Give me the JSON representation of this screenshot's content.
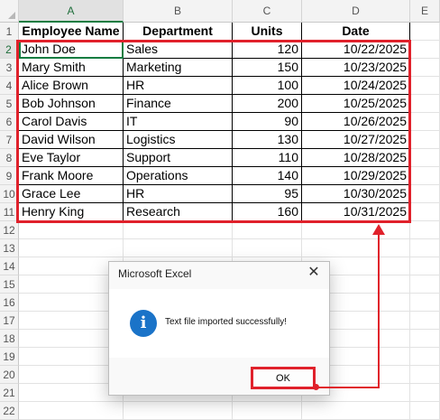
{
  "columns": [
    "A",
    "B",
    "C",
    "D",
    "E"
  ],
  "rows": [
    "1",
    "2",
    "3",
    "4",
    "5",
    "6",
    "7",
    "8",
    "9",
    "10",
    "11",
    "12",
    "13",
    "14",
    "15",
    "16",
    "17",
    "18",
    "19",
    "20",
    "21",
    "22"
  ],
  "table": {
    "headers": [
      "Employee Name",
      "Department",
      "Units",
      "Date"
    ],
    "records": [
      [
        "John Doe",
        "Sales",
        "120",
        "10/22/2025"
      ],
      [
        "Mary Smith",
        "Marketing",
        "150",
        "10/23/2025"
      ],
      [
        "Alice Brown",
        "HR",
        "100",
        "10/24/2025"
      ],
      [
        "Bob Johnson",
        "Finance",
        "200",
        "10/25/2025"
      ],
      [
        "Carol Davis",
        "IT",
        "90",
        "10/26/2025"
      ],
      [
        "David Wilson",
        "Logistics",
        "130",
        "10/27/2025"
      ],
      [
        "Eve Taylor",
        "Support",
        "110",
        "10/28/2025"
      ],
      [
        "Frank Moore",
        "Operations",
        "140",
        "10/29/2025"
      ],
      [
        "Grace Lee",
        "HR",
        "95",
        "10/30/2025"
      ],
      [
        "Henry King",
        "Research",
        "160",
        "10/31/2025"
      ]
    ]
  },
  "dialog": {
    "title": "Microsoft Excel",
    "close_icon": "close-icon",
    "icon": "info-icon",
    "icon_glyph": "i",
    "message": "Text file imported successfully!",
    "ok_label": "OK"
  },
  "colors": {
    "highlight": "#e0212b",
    "selection": "#107c41",
    "info_icon": "#1a73c8"
  }
}
